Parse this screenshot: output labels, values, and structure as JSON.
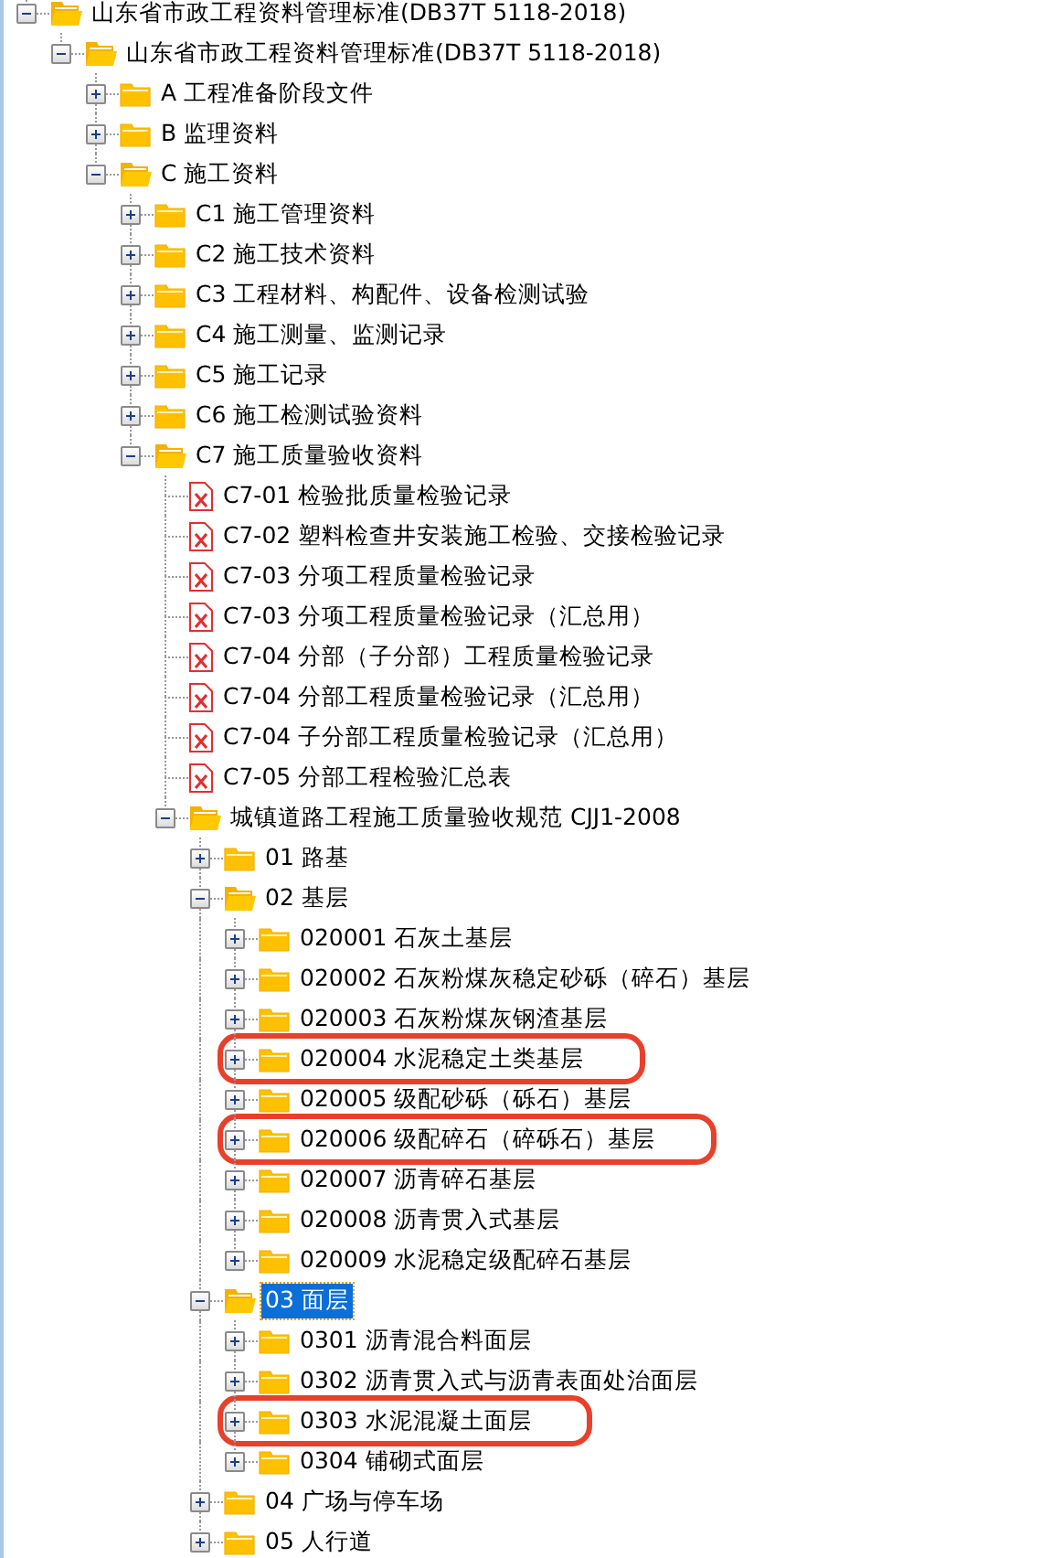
{
  "tree": [
    {
      "label": "山东省市政工程资料管理标准(DB37T 5118-2018)",
      "kind": "folder",
      "expanded": true,
      "selected": false,
      "highlighted": false,
      "children": [
        {
          "label": "山东省市政工程资料管理标准(DB37T 5118-2018)",
          "kind": "folder",
          "expanded": true,
          "selected": false,
          "highlighted": false,
          "children": [
            {
              "label": "A 工程准备阶段文件",
              "kind": "folder",
              "expanded": false,
              "selected": false,
              "highlighted": false
            },
            {
              "label": "B 监理资料",
              "kind": "folder",
              "expanded": false,
              "selected": false,
              "highlighted": false
            },
            {
              "label": "C 施工资料",
              "kind": "folder",
              "expanded": true,
              "selected": false,
              "highlighted": false,
              "children": [
                {
                  "label": "C1 施工管理资料",
                  "kind": "folder",
                  "expanded": false,
                  "selected": false,
                  "highlighted": false
                },
                {
                  "label": "C2 施工技术资料",
                  "kind": "folder",
                  "expanded": false,
                  "selected": false,
                  "highlighted": false
                },
                {
                  "label": "C3 工程材料、构配件、设备检测试验",
                  "kind": "folder",
                  "expanded": false,
                  "selected": false,
                  "highlighted": false
                },
                {
                  "label": "C4 施工测量、监测记录",
                  "kind": "folder",
                  "expanded": false,
                  "selected": false,
                  "highlighted": false
                },
                {
                  "label": "C5 施工记录",
                  "kind": "folder",
                  "expanded": false,
                  "selected": false,
                  "highlighted": false
                },
                {
                  "label": "C6 施工检测试验资料",
                  "kind": "folder",
                  "expanded": false,
                  "selected": false,
                  "highlighted": false
                },
                {
                  "label": "C7 施工质量验收资料",
                  "kind": "folder",
                  "expanded": true,
                  "selected": false,
                  "highlighted": false,
                  "children": [
                    {
                      "label": "C7-01 检验批质量检验记录",
                      "kind": "file",
                      "selected": false,
                      "highlighted": false
                    },
                    {
                      "label": "C7-02 塑料检查井安装施工检验、交接检验记录",
                      "kind": "file",
                      "selected": false,
                      "highlighted": false
                    },
                    {
                      "label": "C7-03 分项工程质量检验记录",
                      "kind": "file",
                      "selected": false,
                      "highlighted": false
                    },
                    {
                      "label": "C7-03 分项工程质量检验记录（汇总用）",
                      "kind": "file",
                      "selected": false,
                      "highlighted": false
                    },
                    {
                      "label": "C7-04 分部（子分部）工程质量检验记录",
                      "kind": "file",
                      "selected": false,
                      "highlighted": false
                    },
                    {
                      "label": "C7-04 分部工程质量检验记录（汇总用）",
                      "kind": "file",
                      "selected": false,
                      "highlighted": false
                    },
                    {
                      "label": "C7-04 子分部工程质量检验记录（汇总用）",
                      "kind": "file",
                      "selected": false,
                      "highlighted": false
                    },
                    {
                      "label": "C7-05 分部工程检验汇总表",
                      "kind": "file",
                      "selected": false,
                      "highlighted": false
                    },
                    {
                      "label": "城镇道路工程施工质量验收规范 CJJ1-2008",
                      "kind": "folder",
                      "expanded": true,
                      "selected": false,
                      "highlighted": false,
                      "children": [
                        {
                          "label": "01 路基",
                          "kind": "folder",
                          "expanded": false,
                          "selected": false,
                          "highlighted": false
                        },
                        {
                          "label": "02 基层",
                          "kind": "folder",
                          "expanded": true,
                          "selected": false,
                          "highlighted": false,
                          "children": [
                            {
                              "label": "020001 石灰土基层",
                              "kind": "folder",
                              "expanded": false,
                              "selected": false,
                              "highlighted": false
                            },
                            {
                              "label": "020002 石灰粉煤灰稳定砂砾（碎石）基层",
                              "kind": "folder",
                              "expanded": false,
                              "selected": false,
                              "highlighted": false
                            },
                            {
                              "label": "020003 石灰粉煤灰钢渣基层",
                              "kind": "folder",
                              "expanded": false,
                              "selected": false,
                              "highlighted": false
                            },
                            {
                              "label": "020004 水泥稳定土类基层",
                              "kind": "folder",
                              "expanded": false,
                              "selected": false,
                              "highlighted": true
                            },
                            {
                              "label": "020005 级配砂砾（砾石）基层",
                              "kind": "folder",
                              "expanded": false,
                              "selected": false,
                              "highlighted": false
                            },
                            {
                              "label": "020006 级配碎石（碎砾石）基层",
                              "kind": "folder",
                              "expanded": false,
                              "selected": false,
                              "highlighted": true
                            },
                            {
                              "label": "020007 沥青碎石基层",
                              "kind": "folder",
                              "expanded": false,
                              "selected": false,
                              "highlighted": false
                            },
                            {
                              "label": "020008 沥青贯入式基层",
                              "kind": "folder",
                              "expanded": false,
                              "selected": false,
                              "highlighted": false
                            },
                            {
                              "label": "020009 水泥稳定级配碎石基层",
                              "kind": "folder",
                              "expanded": false,
                              "selected": false,
                              "highlighted": false
                            }
                          ]
                        },
                        {
                          "label": "03 面层",
                          "kind": "folder",
                          "expanded": true,
                          "selected": true,
                          "highlighted": false,
                          "children": [
                            {
                              "label": "0301 沥青混合料面层",
                              "kind": "folder",
                              "expanded": false,
                              "selected": false,
                              "highlighted": false
                            },
                            {
                              "label": "0302 沥青贯入式与沥青表面处治面层",
                              "kind": "folder",
                              "expanded": false,
                              "selected": false,
                              "highlighted": false
                            },
                            {
                              "label": "0303 水泥混凝土面层",
                              "kind": "folder",
                              "expanded": false,
                              "selected": false,
                              "highlighted": true
                            },
                            {
                              "label": "0304 铺砌式面层",
                              "kind": "folder",
                              "expanded": false,
                              "selected": false,
                              "highlighted": false
                            }
                          ]
                        },
                        {
                          "label": "04 广场与停车场",
                          "kind": "folder",
                          "expanded": false,
                          "selected": false,
                          "highlighted": false
                        },
                        {
                          "label": "05 人行道",
                          "kind": "folder",
                          "expanded": false,
                          "selected": false,
                          "highlighted": false
                        }
                      ]
                    }
                  ]
                }
              ]
            }
          ]
        }
      ]
    }
  ]
}
